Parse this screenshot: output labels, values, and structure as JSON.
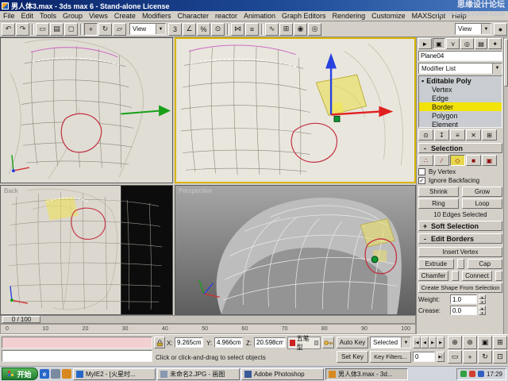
{
  "window": {
    "title": "男人体3.max - 3ds max 6 - Stand-alone License"
  },
  "watermark": {
    "line1": "思缘设计论坛",
    "line2": "WWW.MISSYUAN.COM"
  },
  "menubar": {
    "items": [
      "File",
      "Edit",
      "Tools",
      "Group",
      "Views",
      "Create",
      "Modifiers",
      "Character",
      "reactor",
      "Animation",
      "Graph Editors",
      "Rendering",
      "Customize",
      "MAXScript",
      "Help"
    ]
  },
  "toolbar": {
    "coord_system": "View",
    "render_type": "View"
  },
  "viewports": {
    "back_label": "Back",
    "perspective_label": "Perspective"
  },
  "command_panel": {
    "object_name": "Plane04",
    "modifier_list": "Modifier List",
    "stack": {
      "root": "Editable Poly",
      "children": [
        "Vertex",
        "Edge",
        "Border",
        "Polygon",
        "Element"
      ],
      "selected": "Border"
    },
    "selection": {
      "title": "Selection",
      "state": "-",
      "by_vertex": "By Vertex",
      "by_vertex_check": "",
      "ignore_backfacing": "Ignore Backfacing",
      "check": "✓",
      "shrink": "Shrink",
      "grow": "Grow",
      "ring": "Ring",
      "loop": "Loop",
      "count_text": "10 Edges Selected"
    },
    "soft_selection": {
      "title": "Soft Selection",
      "state": "+"
    },
    "edit_borders": {
      "title": "Edit Borders",
      "state": "-",
      "insert_vertex": "Insert Vertex",
      "extrude": "Extrude",
      "cap": "Cap",
      "chamfer": "Chamfer",
      "connect": "Connect",
      "create_shape": "Create Shape From Selection",
      "weight_label": "Weight:",
      "weight_value": "1.0",
      "crease_label": "Crease:",
      "crease_value": "0.0"
    }
  },
  "timeline": {
    "slider_label": "0 / 100",
    "ticks": [
      "0",
      "10",
      "20",
      "30",
      "40",
      "50",
      "60",
      "70",
      "80",
      "90",
      "100"
    ]
  },
  "status": {
    "coords": {
      "x_label": "X:",
      "x": "9.265cm",
      "y_label": "Y:",
      "y": "4.966cm",
      "z_label": "Z:",
      "z": "20.598cm"
    },
    "ime": "五笔型",
    "prompt": "Click or click-and-drag to select objects",
    "auto_key": "Auto Key",
    "set_key": "Set Key",
    "selected": "Selected",
    "key_filters": "Key Filters...",
    "frame": "0"
  },
  "taskbar": {
    "start": "开始",
    "tasks": [
      "MyIE2 - [火星时...",
      "未命名2.JPG - 画图",
      "Adobe Photoshop",
      "男人体3.max - 3d..."
    ],
    "time": "17:29"
  },
  "icons": {
    "undo": "↶",
    "redo": "↷",
    "select": "▭",
    "select_by_name": "▤",
    "region": "◻",
    "move": "+",
    "rotate": "↻",
    "scale": "▱",
    "dropdown": "▼",
    "snap_3d": "3",
    "snap_angle": "∠",
    "snap_percent": "%",
    "snap_spinner": "⊙",
    "mirror": "⋈",
    "align": "≡",
    "curve_editor": "∿",
    "schematic": "⊞",
    "material": "◉",
    "render": "◎",
    "quick_render": "●",
    "tab_create": "►",
    "tab_modify": "▣",
    "tab_hierarchy": "⋎",
    "tab_motion": "◎",
    "tab_display": "▤",
    "tab_utilities": "✦",
    "stack_bullet": "▪",
    "pin": "⊙",
    "show_end": "↧",
    "make_unique": "≡",
    "remove": "✕",
    "configure": "⊞",
    "so_vertex": "∴",
    "so_edge": "∕",
    "so_border": "◇",
    "so_polygon": "■",
    "so_element": "▣",
    "spin_up": "▲",
    "spin_down": "▼",
    "t_start": "|◀",
    "t_prev": "◀",
    "t_play": "▶",
    "t_next": "▶",
    "t_end": "▶|",
    "n_zoom": "⊕",
    "n_zoom_all": "⊛",
    "n_extents": "▣",
    "n_extents_all": "⊞",
    "n_region": "▭",
    "n_pan": "+",
    "n_arc": "↻",
    "n_maximize": "⊡",
    "quick_ie": "e",
    "ps": "Ps"
  },
  "colors": {
    "titlebar": "#0a246a",
    "active_viewport_border": "#d9b400",
    "stack_highlight": "#f2e30a",
    "selection_red": "#c23040",
    "gizmo_x": "#e02020",
    "gizmo_y": "#18a018",
    "gizmo_z": "#2840e0",
    "start_green": "#2f9e3f",
    "paper": "#e0ddd5",
    "perspective_bg": "#7a7a7a"
  }
}
